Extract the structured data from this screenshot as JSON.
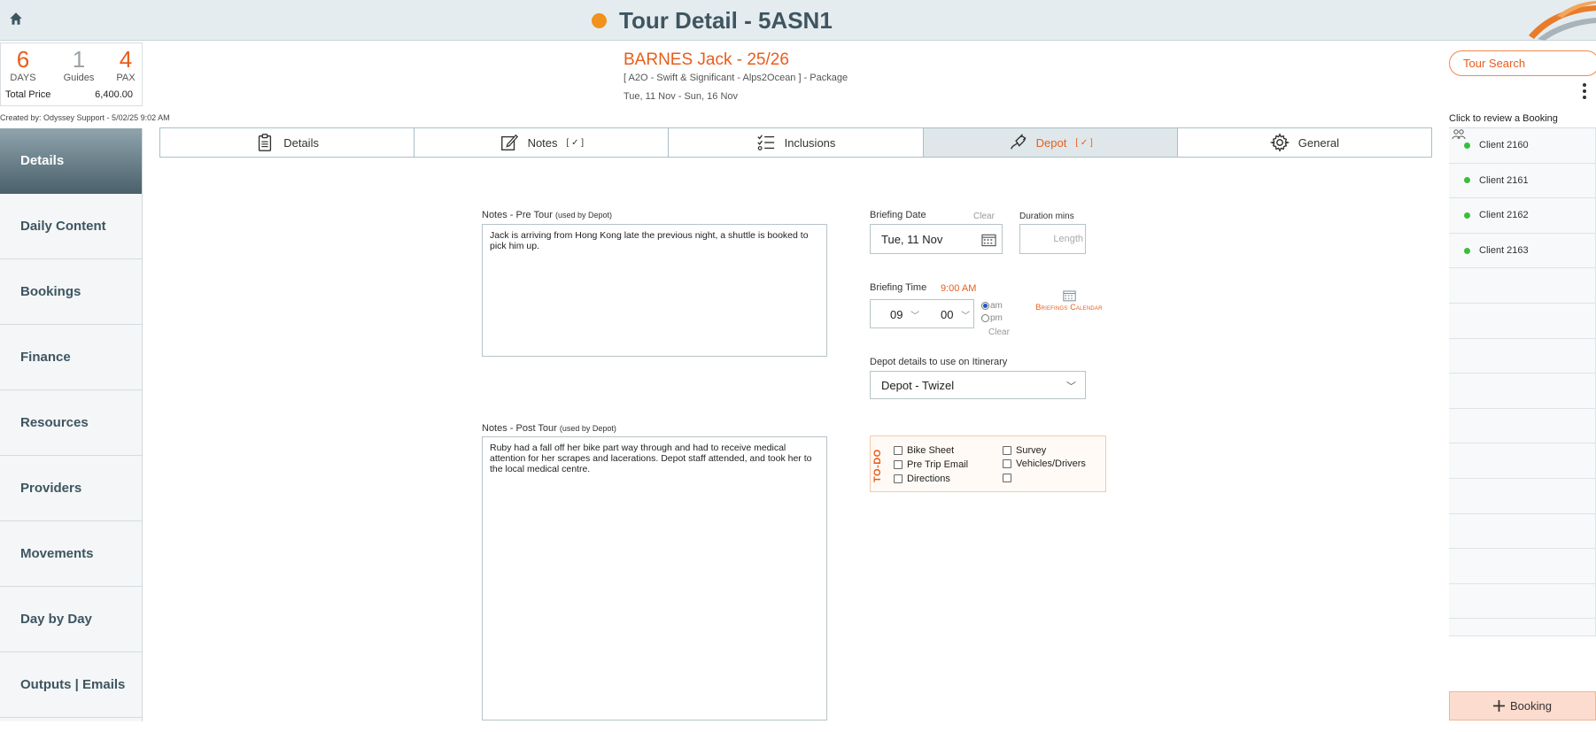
{
  "header": {
    "title": "Tour Detail - 5ASN1",
    "status_color": "#f0921c"
  },
  "summary": {
    "days_value": "6",
    "days_label": "DAYS",
    "guides_value": "1",
    "guides_label": "Guides",
    "pax_value": "4",
    "pax_label": "PAX",
    "price_label": "Total Price",
    "price_value": "6,400.00",
    "created_by": "Created by: Odyssey Support - 5/02/25 9:02 AM"
  },
  "booking_info": {
    "name": "BARNES Jack - 25/26",
    "package": "[ A2O - Swift & Significant - Alps2Ocean ] - Package",
    "dates": "Tue, 11 Nov  - Sun, 16 Nov"
  },
  "tour_search": {
    "label": "Tour Search"
  },
  "sidebar": {
    "items": [
      {
        "label": "Details"
      },
      {
        "label": "Daily Content"
      },
      {
        "label": "Bookings"
      },
      {
        "label": "Finance"
      },
      {
        "label": "Resources"
      },
      {
        "label": "Providers"
      },
      {
        "label": "Movements"
      },
      {
        "label": "Day by Day"
      },
      {
        "label": "Outputs | Emails"
      }
    ]
  },
  "tabs": [
    {
      "label": "Details",
      "check": ""
    },
    {
      "label": "Notes",
      "check": "[ ✓ ]"
    },
    {
      "label": "Inclusions",
      "check": ""
    },
    {
      "label": "Depot",
      "check": "[ ✓ ]"
    },
    {
      "label": "General",
      "check": ""
    }
  ],
  "depot": {
    "pre_tour_label": "Notes - Pre Tour",
    "pre_tour_sub": "(used by Depot)",
    "pre_tour_text": "Jack is arriving from Hong Kong late the previous night, a shuttle is booked to pick him up.",
    "post_tour_label": "Notes - Post Tour",
    "post_tour_sub": "(used by Depot)",
    "post_tour_text": "Ruby had a fall off her bike part way through and had to receive medical attention for her scrapes and lacerations. Depot staff attended, and took her to the local medical centre.",
    "briefing_date_label": "Briefing Date",
    "briefing_date_value": "Tue, 11 Nov",
    "clear_label": "Clear",
    "duration_label": "Duration mins",
    "duration_placeholder": "Length",
    "briefing_time_label": "Briefing Time",
    "briefing_time_value": "9:00 AM",
    "hour": "09",
    "minute": "00",
    "am_label": "am",
    "pm_label": "pm",
    "briefings_calendar_label": "Briefings Calendar",
    "depot_details_label": "Depot details to use on Itinerary",
    "depot_selected": "Depot - Twizel"
  },
  "todo": {
    "title": "TO-DO",
    "items": [
      {
        "label": "Bike Sheet"
      },
      {
        "label": "Pre Trip Email"
      },
      {
        "label": "Directions"
      },
      {
        "label": "Survey"
      },
      {
        "label": "Vehicles/Drivers"
      },
      {
        "label": ""
      }
    ]
  },
  "bookings": {
    "header": "Click to review a Booking",
    "clients": [
      {
        "label": "Client 2160"
      },
      {
        "label": "Client 2161"
      },
      {
        "label": "Client 2162"
      },
      {
        "label": "Client 2163"
      }
    ],
    "add_label": "Booking"
  },
  "colors": {
    "accent": "#e85d1a",
    "sidebar_active": "#4b616b",
    "client_dot": "#3cbd3c"
  }
}
